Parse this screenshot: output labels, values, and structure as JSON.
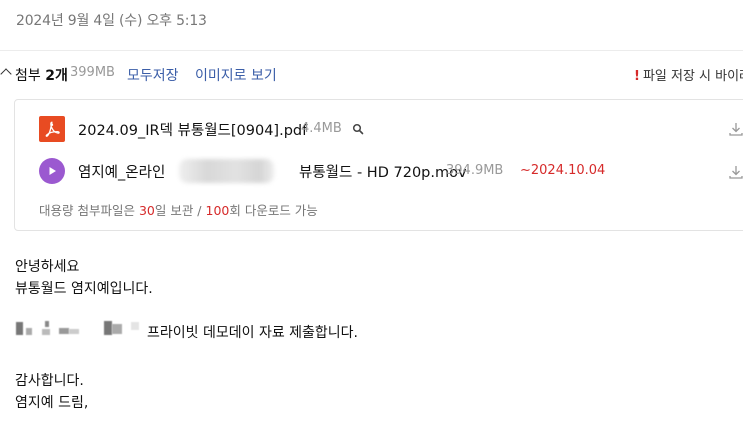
{
  "header": {
    "date": "2024년 9월 4일 (수) 오후 5:13"
  },
  "attachments": {
    "title_prefix": "첨부 ",
    "title_count": "2개",
    "total_size": "399MB",
    "save_all_label": "모두저장",
    "view_as_image_label": "이미지로 보기",
    "warning_text": "파일 저장 시 바이러",
    "files": [
      {
        "name": "2024.09_IR덱 뷰통월드[0904].pdf",
        "size": "4.4MB",
        "icon": "pdf-icon"
      },
      {
        "name_prefix": "염지예_온라인",
        "name_suffix": "뷰통월드 - HD 720p.mov",
        "size": "394.9MB",
        "expiry": "~2024.10.04",
        "icon": "play-icon"
      }
    ],
    "note": {
      "part1": "대용량 첨부파일은 ",
      "days": "30",
      "part2": "일 보관 / ",
      "downloads": "100",
      "part3": "회 다운로드 가능"
    }
  },
  "body": {
    "line1": "안녕하세요",
    "line2": "뷰통월드 염지예입니다.",
    "line3": "프라이빗 데모데이 자료 제출합니다.",
    "line4": "감사합니다.",
    "line5": "염지예 드림,"
  },
  "colors": {
    "link": "#3b5ea8",
    "alert": "#d62a2a",
    "pdf": "#e84b22",
    "video": "#9b59d0"
  }
}
